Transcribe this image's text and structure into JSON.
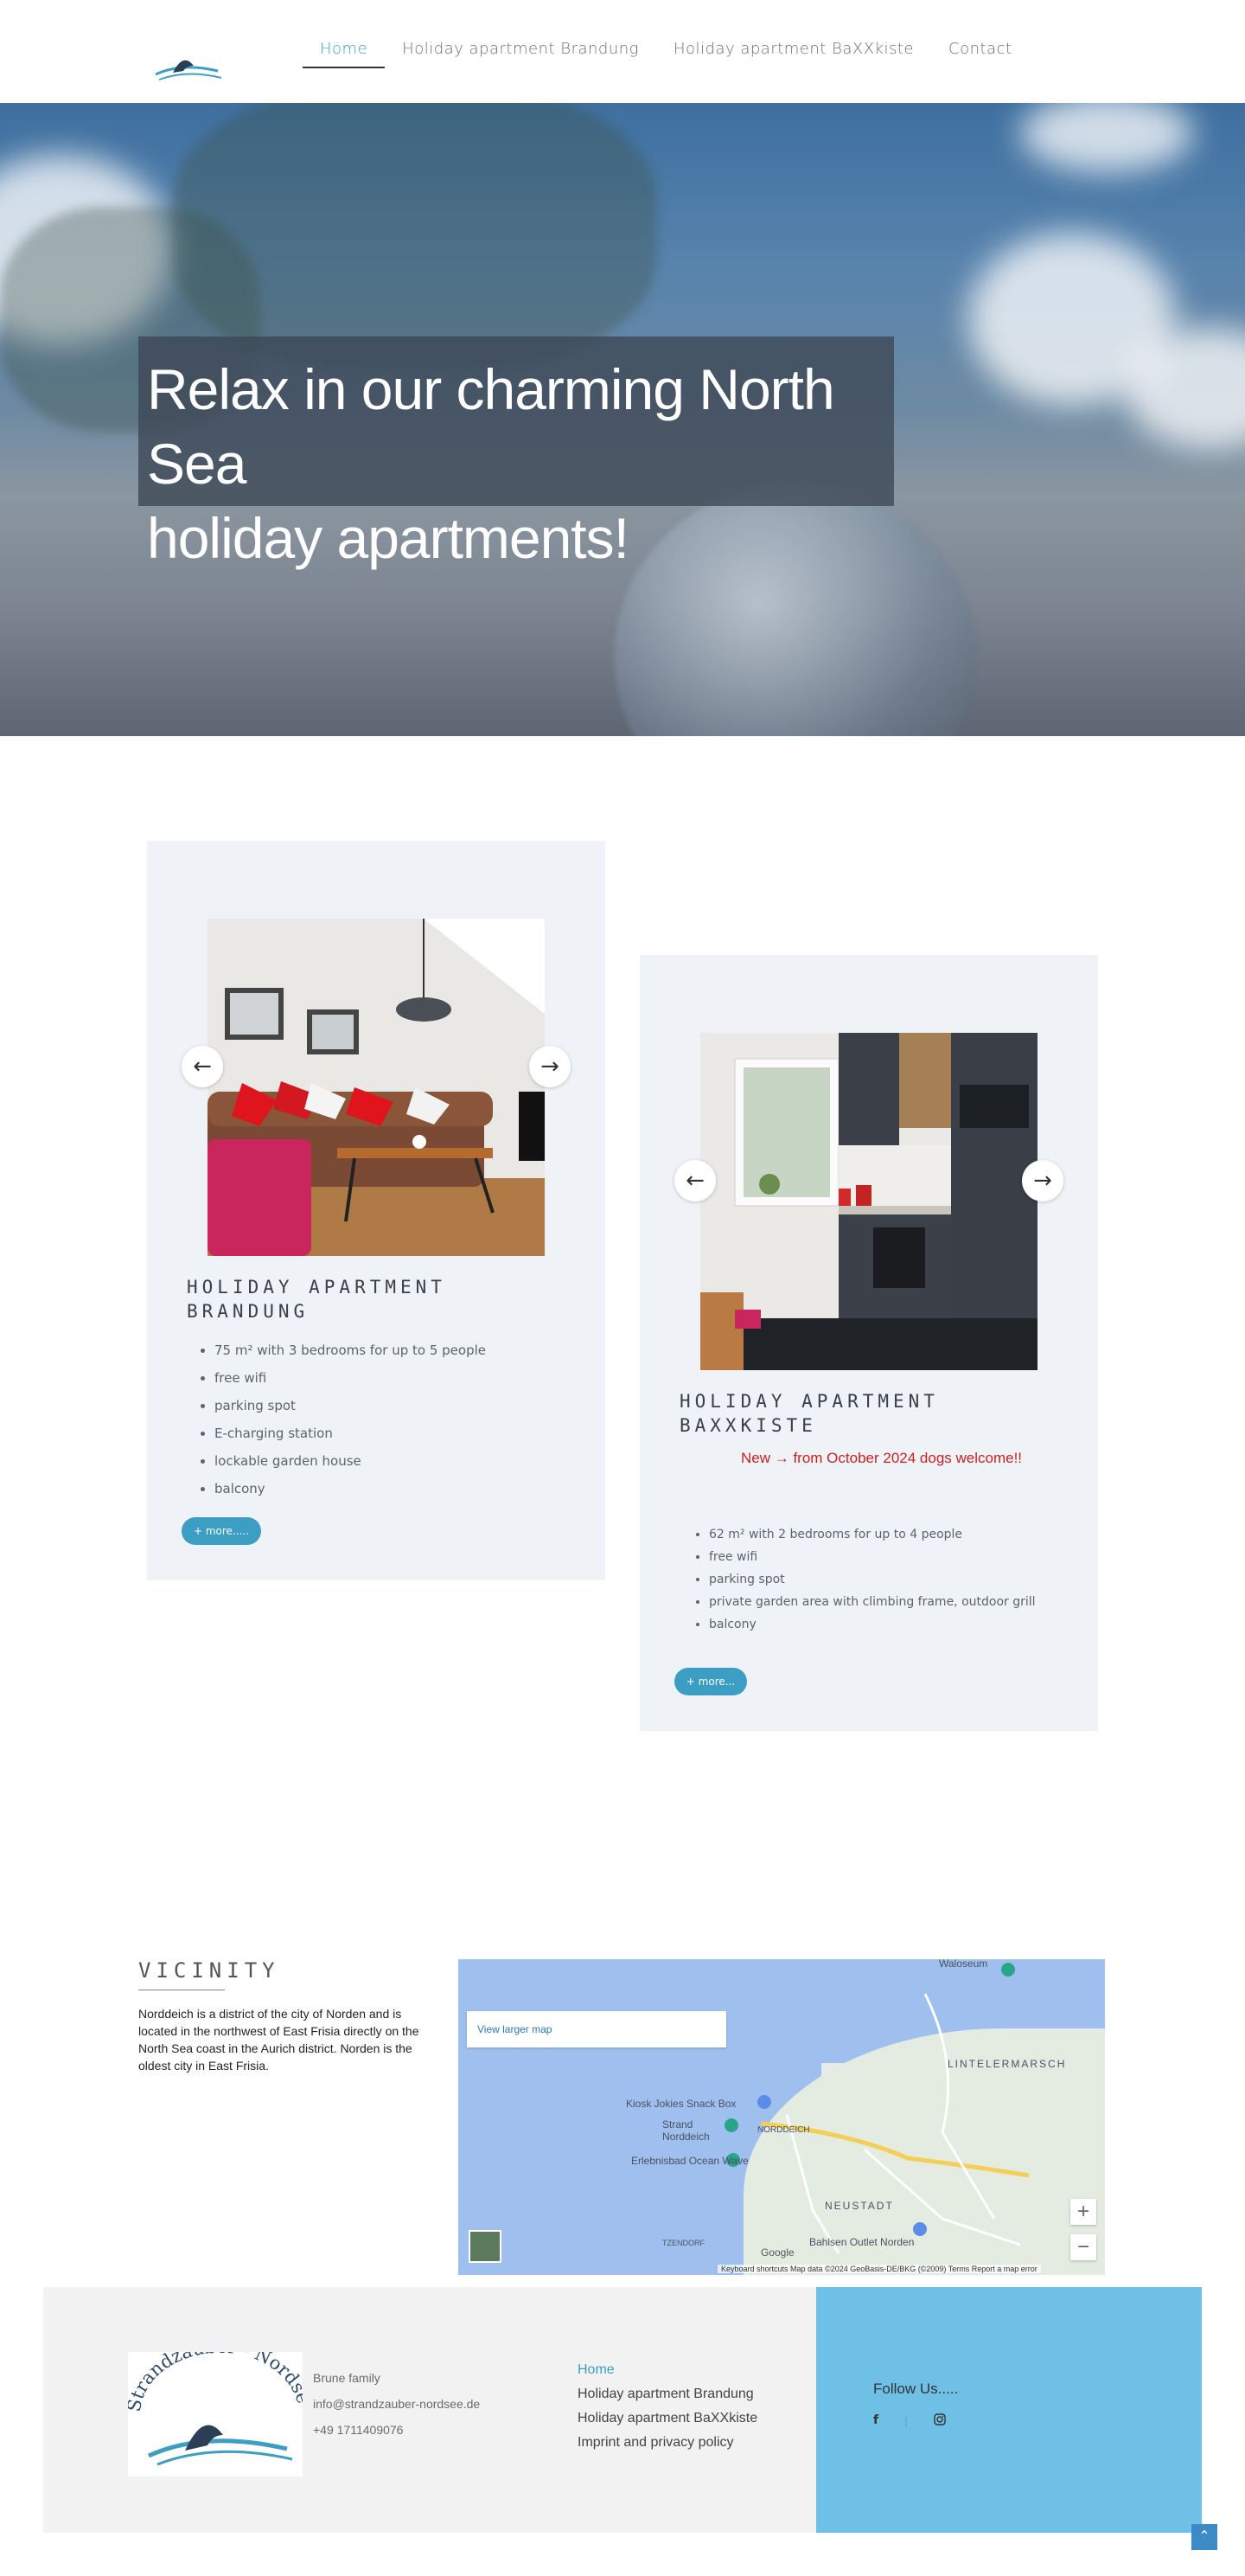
{
  "brand": {
    "name": "Strandzauber - Nordsee"
  },
  "nav": {
    "items": [
      {
        "label": "Home",
        "active": true
      },
      {
        "label": "Holiday apartment Brandung"
      },
      {
        "label": "Holiday apartment BaXXkiste"
      },
      {
        "label": "Contact"
      }
    ]
  },
  "hero": {
    "headline_line1": "Relax in our charming North Sea",
    "headline_line2": "holiday apartments!"
  },
  "apartments": [
    {
      "title_line1": "HOLIDAY APARTMENT",
      "title_line2": "BRANDUNG",
      "features": [
        "75 m² with 3 bedrooms for up to 5 people",
        "free wifi",
        "parking spot",
        "E-charging station",
        "lockable garden house",
        "balcony"
      ],
      "more_label": "+ more....."
    },
    {
      "title_line1": "HOLIDAY APARTMENT",
      "title_line2": "BAXXKISTE",
      "notice": "New → from October 2024 dogs welcome!!",
      "features": [
        "62 m² with 2 bedrooms for up to 4 people",
        "free wifi",
        "parking spot",
        "private garden area with climbing frame, outdoor grill",
        "balcony"
      ],
      "more_label": "+ more..."
    }
  ],
  "vicinity": {
    "title": "VICINITY",
    "text": "Norddeich is a district of the city of Norden and is located in the northwest of East Frisia directly on the North Sea coast in the Aurich district. Norden is the oldest city in East Frisia."
  },
  "map": {
    "larger_link": "View larger map",
    "labels": [
      "Waloseum",
      "LINTELERMARSCH",
      "Kiosk Jokies Snack Box",
      "Strand Norddeich",
      "NORDDEICH",
      "Erlebnisbad Ocean Wave",
      "NEUSTADT",
      "Bahlsen Outlet Norden",
      "TZENDORF"
    ],
    "footer": "Keyboard shortcuts   Map data ©2024 GeoBasis-DE/BKG (©2009)   Terms   Report a map error",
    "google": "Google"
  },
  "footer": {
    "contact": [
      "Brune family",
      "info@strandzauber-nordsee.de",
      "+49 1711409076"
    ],
    "links": [
      {
        "label": "Home",
        "active": true
      },
      {
        "label": "Holiday apartment Brandung"
      },
      {
        "label": "Holiday apartment BaXXkiste"
      },
      {
        "label": "Imprint and privacy policy"
      }
    ],
    "follow": "Follow Us.....",
    "social": [
      "facebook-icon",
      "instagram-icon"
    ]
  },
  "colors": {
    "accent": "#3d9ec4",
    "footer_blue": "#6fc0e6",
    "card_bg": "#eff3f7",
    "notice_red": "#cc1f1f"
  }
}
